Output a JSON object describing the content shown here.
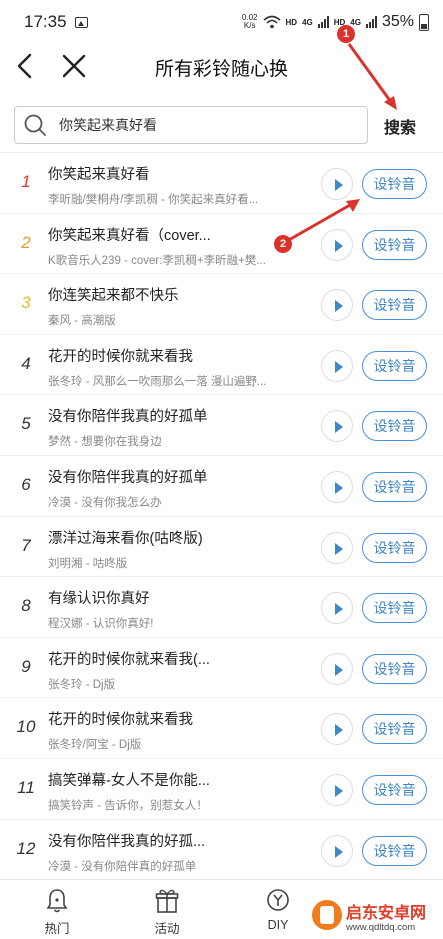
{
  "status_bar": {
    "time": "17:35",
    "net_speed_value": "0.02",
    "net_speed_unit": "K/s",
    "network_label_1": "HD",
    "network_label_2": "4G",
    "network_label_3": "HD",
    "network_label_4": "4G",
    "battery": "35%"
  },
  "header": {
    "title": "所有彩铃随心换",
    "back_icon": "chevron-left-icon",
    "close_icon": "close-icon"
  },
  "search": {
    "value": "你笑起来真好看",
    "button_label": "搜索"
  },
  "list": {
    "set_label": "设铃音",
    "items": [
      {
        "rank": "1",
        "title": "你笑起来真好看",
        "subtitle": "李昕融/樊桐舟/李凯稠 - 你笑起来真好看..."
      },
      {
        "rank": "2",
        "title": "你笑起来真好看（cover...",
        "subtitle": "K歌音乐人239 - cover:李凯稠+李昕融+樊..."
      },
      {
        "rank": "3",
        "title": "你连笑起来都不快乐",
        "subtitle": "秦风 - 高潮版"
      },
      {
        "rank": "4",
        "title": "花开的时候你就来看我",
        "subtitle": "张冬玲 - 风那么一吹雨那么一落 漫山遍野..."
      },
      {
        "rank": "5",
        "title": "没有你陪伴我真的好孤单",
        "subtitle": "梦然 - 想要你在我身边"
      },
      {
        "rank": "6",
        "title": "没有你陪伴我真的好孤单",
        "subtitle": "冷漠 - 没有你我怎么办"
      },
      {
        "rank": "7",
        "title": "漂洋过海来看你(咕咚版)",
        "subtitle": "刘明湘 - 咕咚版"
      },
      {
        "rank": "8",
        "title": "有缘认识你真好",
        "subtitle": "程汉娜 - 认识你真好!"
      },
      {
        "rank": "9",
        "title": "花开的时候你就来看我(...",
        "subtitle": "张冬玲 - Dj版"
      },
      {
        "rank": "10",
        "title": "花开的时候你就来看我",
        "subtitle": "张冬玲/阿宝 - Dj版"
      },
      {
        "rank": "11",
        "title": "搞笑弹幕-女人不是你能...",
        "subtitle": "搞笑铃声 - 告诉你，别惹女人！"
      },
      {
        "rank": "12",
        "title": "没有你陪伴我真的好孤...",
        "subtitle": "冷漠 - 没有你陪伴真的好孤单"
      }
    ]
  },
  "annotations": {
    "marker_1": "1",
    "marker_2": "2",
    "color": "#d9332b"
  },
  "tab_bar": {
    "tabs": [
      {
        "label": "热门",
        "icon": "bell-icon"
      },
      {
        "label": "活动",
        "icon": "gift-icon"
      },
      {
        "label": "DIY",
        "icon": "diy-icon"
      }
    ]
  },
  "watermark": {
    "name": "启东安卓网",
    "url": "www.qdltdq.com"
  },
  "colors": {
    "accent": "#3e86c8",
    "rank_1": "#e0352b",
    "rank_2": "#e89a2b",
    "rank_3": "#e8b92b"
  }
}
